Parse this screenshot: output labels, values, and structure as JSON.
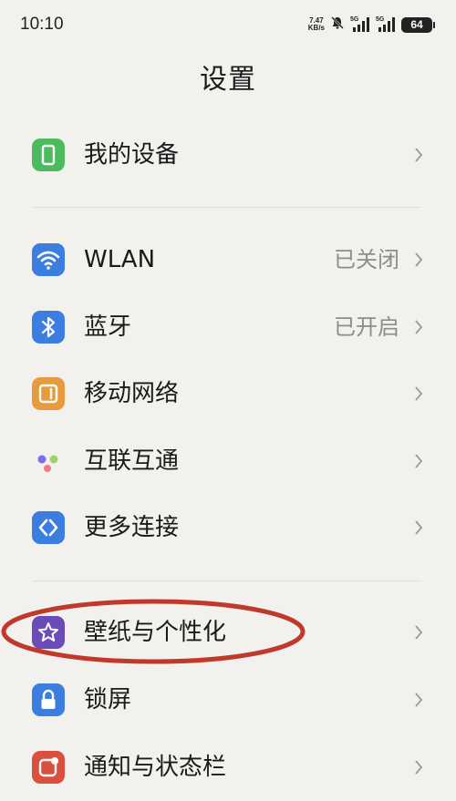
{
  "status_bar": {
    "time": "10:10",
    "net_speed_value": "7.47",
    "net_speed_unit": "KB/s",
    "signal_1_label": "5G",
    "signal_2_label": "5G",
    "battery_level": "64"
  },
  "page": {
    "title": "设置"
  },
  "groups": [
    {
      "items": [
        {
          "label": "我的设备",
          "value": "",
          "icon": "device-icon",
          "icon_color": "#4cba5e"
        }
      ]
    },
    {
      "items": [
        {
          "label": "WLAN",
          "value": "已关闭",
          "icon": "wifi-icon",
          "icon_color": "#3b7ee0"
        },
        {
          "label": "蓝牙",
          "value": "已开启",
          "icon": "bluetooth-icon",
          "icon_color": "#3b7ee0"
        },
        {
          "label": "移动网络",
          "value": "",
          "icon": "mobile-network-icon",
          "icon_color": "#e99a3c"
        },
        {
          "label": "互联互通",
          "value": "",
          "icon": "interconnect-icon",
          "icon_color": "#ffffff"
        },
        {
          "label": "更多连接",
          "value": "",
          "icon": "more-connections-icon",
          "icon_color": "#3b7ee0"
        }
      ]
    },
    {
      "items": [
        {
          "label": "壁纸与个性化",
          "value": "",
          "icon": "wallpaper-icon",
          "icon_color": "#6a4bb8"
        },
        {
          "label": "锁屏",
          "value": "",
          "icon": "lock-screen-icon",
          "icon_color": "#3b7ee0"
        },
        {
          "label": "通知与状态栏",
          "value": "",
          "icon": "notification-icon",
          "icon_color": "#d9503e"
        }
      ]
    }
  ],
  "annotation": {
    "highlight_color": "#c0392b"
  }
}
